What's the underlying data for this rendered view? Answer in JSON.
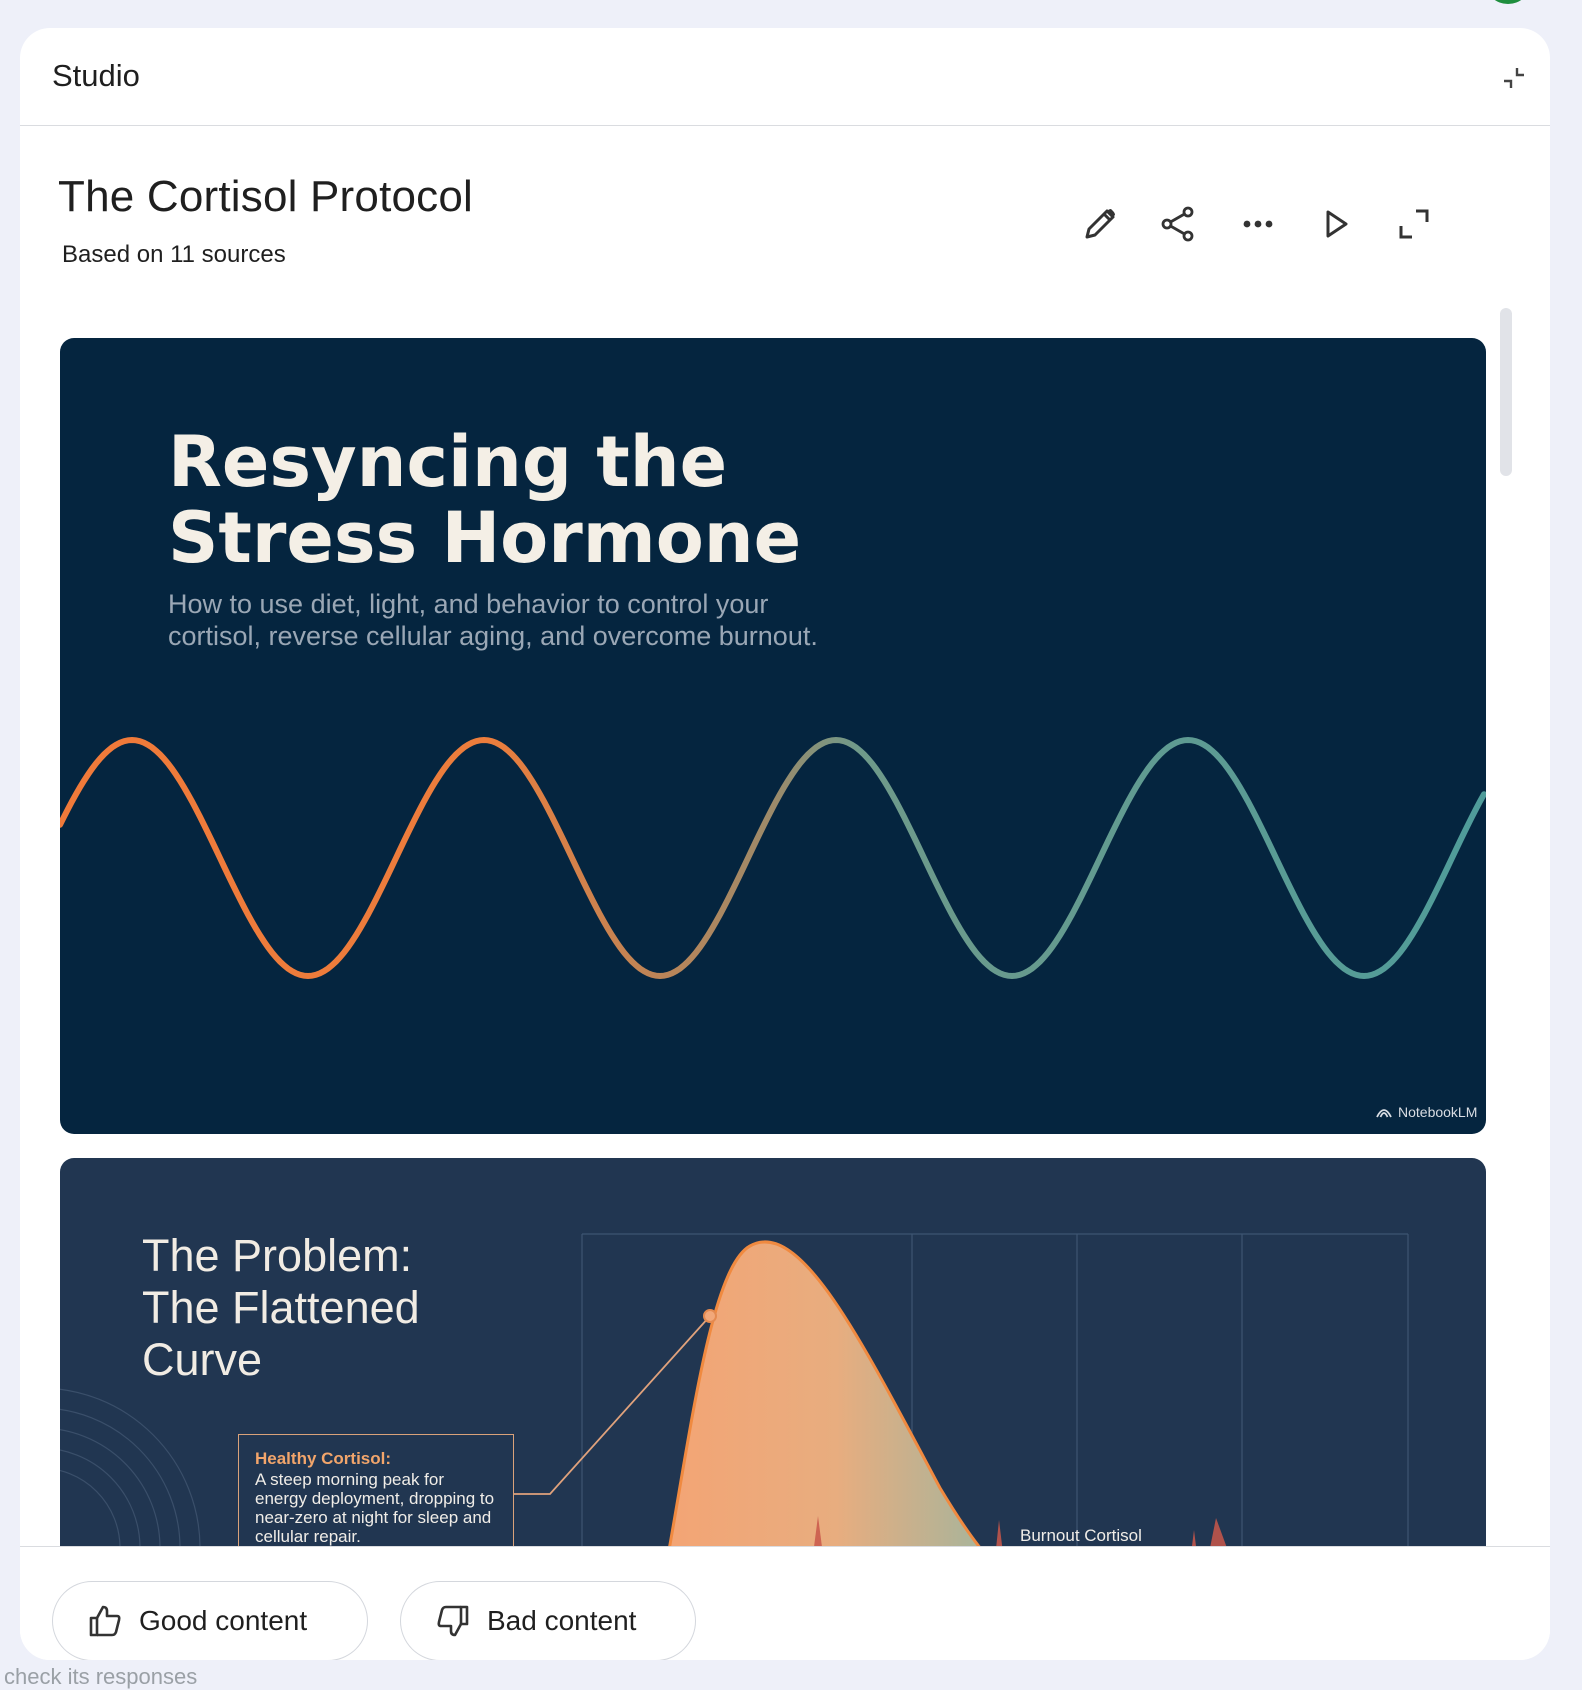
{
  "panel": {
    "title": "Studio"
  },
  "document": {
    "title": "The Cortisol Protocol",
    "subtitle": "Based on 11 sources",
    "toolbar_icons": [
      "pencil-icon",
      "share-icon",
      "more-icon",
      "play-icon",
      "fullscreen-icon"
    ]
  },
  "slides": [
    {
      "title": "Resyncing the Stress Hormone",
      "subtitle": "How to use diet, light, and behavior to control your cortisol, reverse cellular aging, and overcome burnout.",
      "brand": "NotebookLM"
    },
    {
      "title": "The Problem: The Flattened Curve",
      "callout_heading": "Healthy Cortisol:",
      "callout_body": "A steep morning peak for energy deployment, dropping to near-zero at night for sleep and cellular repair.",
      "series_label": "Burnout Cortisol"
    }
  ],
  "feedback": {
    "good_label": "Good content",
    "bad_label": "Bad content"
  },
  "footer_text": "check its responses",
  "colors": {
    "page_bg": "#eef0f9",
    "slide1_bg": "#05253f",
    "slide2_bg": "#213651",
    "wave_orange": "#f07a3a",
    "wave_teal": "#52a0a0",
    "curve_fill": "#f2a87a"
  }
}
